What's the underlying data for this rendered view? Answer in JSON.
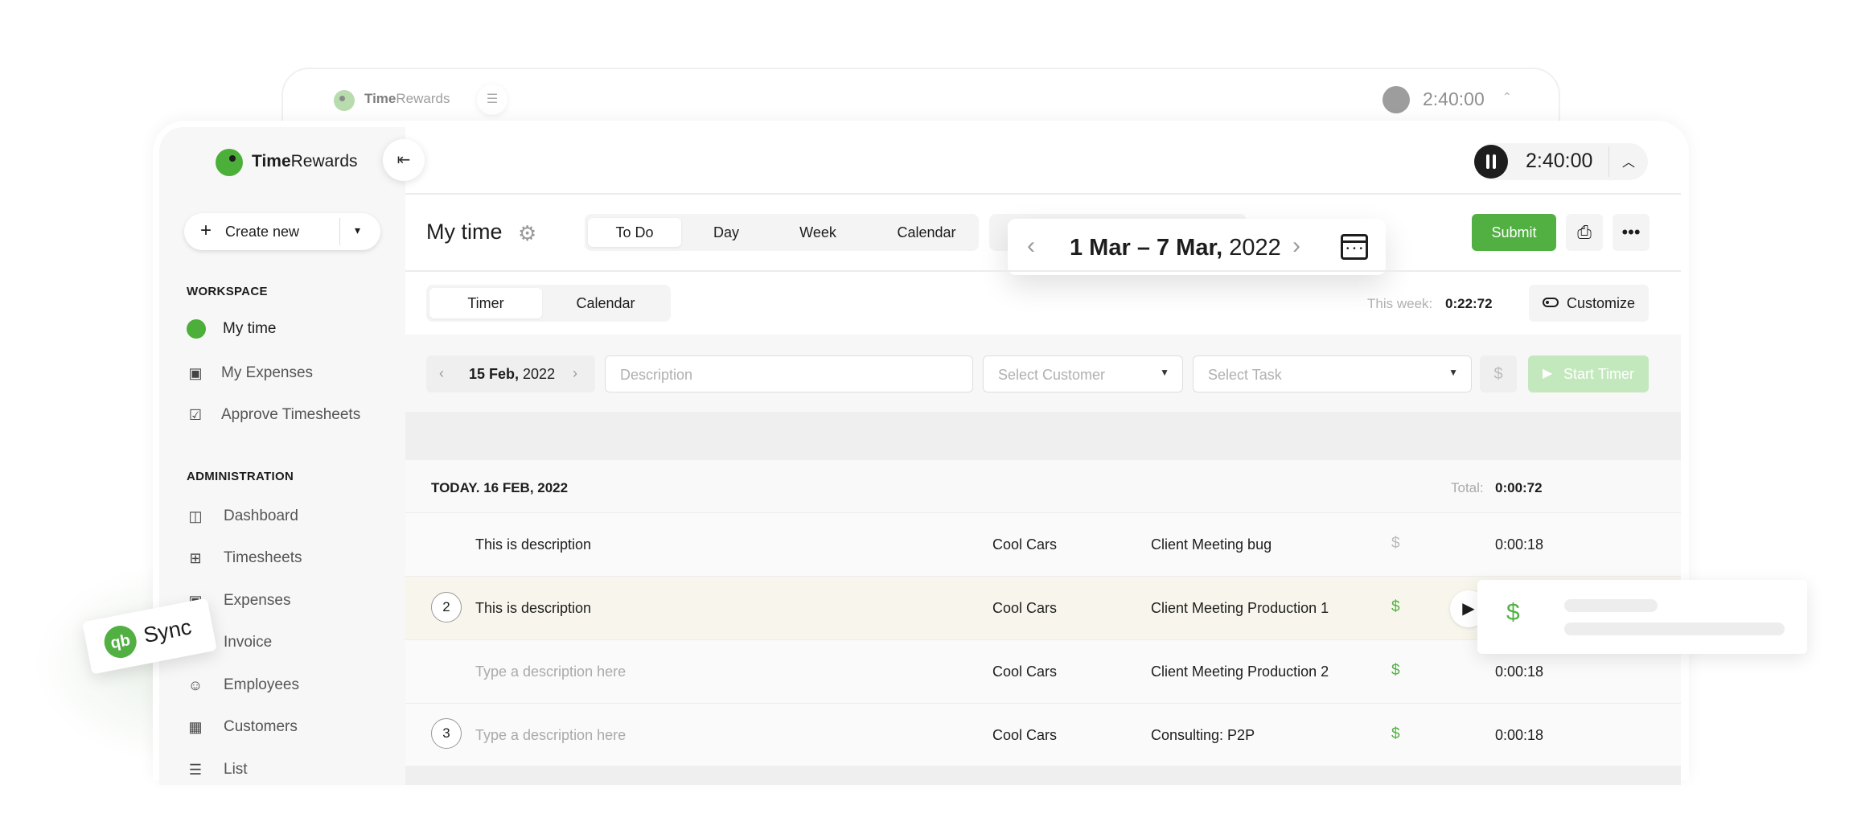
{
  "ghost": {
    "brand_a": "Time",
    "brand_b": "Rewards",
    "timer": "2:40:00"
  },
  "brand": {
    "a": "Time",
    "b": "Rewards"
  },
  "timer": "2:40:00",
  "sidebar": {
    "create_label": "Create new",
    "workspace_heading": "WORKSPACE",
    "workspace_items": [
      {
        "label": "My time",
        "icon": "gauge-icon"
      },
      {
        "label": "My Expenses",
        "icon": "wallet-icon"
      },
      {
        "label": "Approve Timesheets",
        "icon": "check-square-icon"
      }
    ],
    "admin_heading": "ADMINISTRATION",
    "admin_items": [
      {
        "label": "Dashboard",
        "icon": "layout-icon"
      },
      {
        "label": "Timesheets",
        "icon": "grid-icon"
      },
      {
        "label": "Expenses",
        "icon": "wallet-icon"
      },
      {
        "label": "Invoice",
        "icon": "invoice-icon"
      },
      {
        "label": "Employees",
        "icon": "people-icon"
      },
      {
        "label": "Customers",
        "icon": "customers-icon"
      },
      {
        "label": "List",
        "icon": "list-icon"
      }
    ]
  },
  "header": {
    "title": "My time",
    "view_tabs": [
      "To Do",
      "Day",
      "Week",
      "Calendar"
    ],
    "date_range_bold": "1 Mar – 7 Mar,",
    "date_range_year": " 2022",
    "submit_label": "Submit"
  },
  "subheader": {
    "mode_tabs": [
      "Timer",
      "Calendar"
    ],
    "this_week_label": "This week:",
    "this_week_value": "0:22:72",
    "customize_label": "Customize"
  },
  "entry": {
    "date_bold": "15 Feb,",
    "date_year": " 2022",
    "description_placeholder": "Description",
    "customer_placeholder": "Select Customer",
    "task_placeholder": "Select Task",
    "dollar": "$",
    "start_label": "Start Timer"
  },
  "day": {
    "title": "TODAY. 16 FEB, 2022",
    "total_label": "Total:",
    "total_value": "0:00:72"
  },
  "rows": [
    {
      "badge": "",
      "description": "This is description",
      "placeholder": false,
      "customer": "Cool Cars",
      "task": "Client Meeting bug",
      "billable": false,
      "dollar": "$",
      "time": "0:00:18"
    },
    {
      "badge": "2",
      "description": "This is description",
      "placeholder": false,
      "customer": "Cool Cars",
      "task": "Client Meeting Production 1",
      "billable": true,
      "dollar": "$",
      "time": ""
    },
    {
      "badge": "",
      "description": "Type a description here",
      "placeholder": true,
      "customer": "Cool Cars",
      "task": "Client Meeting Production 2",
      "billable": true,
      "dollar": "$",
      "time": "0:00:18"
    },
    {
      "badge": "3",
      "description": "Type a description here",
      "placeholder": true,
      "customer": "Cool Cars",
      "task": "Consulting: P2P",
      "billable": true,
      "dollar": "$",
      "time": "0:00:18"
    }
  ],
  "billable_card": {
    "symbol": "$"
  },
  "sync_badge": {
    "label": "Sync",
    "logo": "qb"
  },
  "colors": {
    "accent": "#52b043",
    "accent_light": "#c4e8bd",
    "highlight_row": "#f8f6ec",
    "text": "#1d1d1d"
  }
}
